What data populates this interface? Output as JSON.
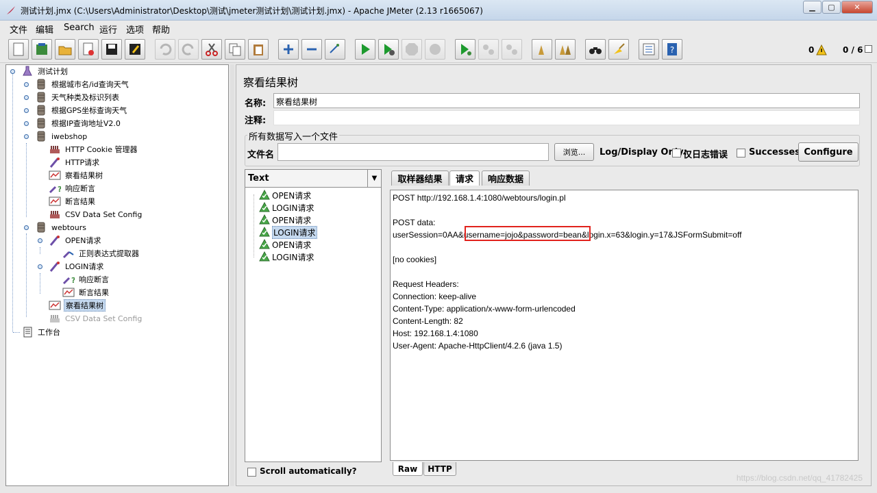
{
  "window": {
    "title": "测试计划.jmx (C:\\Users\\Administrator\\Desktop\\测试\\jmeter测试计划\\测试计划.jmx) - Apache JMeter (2.13 r1665067)",
    "minimize": "▁",
    "maximize": "▢",
    "close": "✕"
  },
  "menu": [
    "文件",
    "编辑",
    "Search",
    "运行",
    "选项",
    "帮助"
  ],
  "toolbar": {
    "warnings_count": "0",
    "threads": "0 / 6"
  },
  "tree": {
    "items": [
      {
        "label": "测试计划",
        "icon": "flask-icon"
      },
      {
        "label": "根据城市名/id查询天气",
        "icon": "thread-group-icon"
      },
      {
        "label": "天气种类及标识列表",
        "icon": "thread-group-icon"
      },
      {
        "label": "根据GPS坐标查询天气",
        "icon": "thread-group-icon"
      },
      {
        "label": "根据IP查询地址V2.0",
        "icon": "thread-group-icon"
      },
      {
        "label": "iwebshop",
        "icon": "thread-group-icon"
      },
      {
        "label": "HTTP Cookie 管理器",
        "icon": "config-icon"
      },
      {
        "label": "HTTP请求",
        "icon": "sampler-icon"
      },
      {
        "label": "察看结果树",
        "icon": "listener-icon"
      },
      {
        "label": "响应断言",
        "icon": "assertion-icon"
      },
      {
        "label": "断言结果",
        "icon": "listener-icon"
      },
      {
        "label": "CSV Data Set Config",
        "icon": "config-icon"
      },
      {
        "label": "webtours",
        "icon": "thread-group-icon"
      },
      {
        "label": "OPEN请求",
        "icon": "sampler-icon"
      },
      {
        "label": "正则表达式提取器",
        "icon": "extractor-icon"
      },
      {
        "label": "LOGIN请求",
        "icon": "sampler-icon"
      },
      {
        "label": "响应断言",
        "icon": "assertion-icon"
      },
      {
        "label": "断言结果",
        "icon": "listener-icon"
      },
      {
        "label": "察看结果树",
        "icon": "listener-icon"
      },
      {
        "label": "CSV Data Set Config",
        "icon": "config-icon"
      },
      {
        "label": "工作台",
        "icon": "workbench-icon"
      }
    ]
  },
  "panel": {
    "title": "察看结果树",
    "name_label": "名称:",
    "name_value": "察看结果树",
    "comment_label": "注释:",
    "comment_value": "",
    "group_title": "所有数据写入一个文件",
    "filename_label": "文件名",
    "filename_value": "",
    "browse_button": "浏览...",
    "log_display_label": "Log/Display Only:",
    "errors_only_label": "仅日志错误",
    "successes_label": "Successes",
    "configure_button": "Configure"
  },
  "results": {
    "renderer": "Text",
    "items": [
      "OPEN请求",
      "LOGIN请求",
      "OPEN请求",
      "LOGIN请求",
      "OPEN请求",
      "LOGIN请求"
    ],
    "scroll_label": "Scroll automatically?"
  },
  "tabs": [
    "取样器结果",
    "请求",
    "响应数据"
  ],
  "request": {
    "lines": [
      "POST http://192.168.1.4:1080/webtours/login.pl",
      "",
      "POST data:",
      "userSession=0AA&username=jojo&password=bean&login.x=63&login.y=17&JSFormSubmit=off",
      "",
      "[no cookies]",
      "",
      "Request Headers:",
      "Connection: keep-alive",
      "Content-Type: application/x-www-form-urlencoded",
      "Content-Length: 82",
      "Host: 192.168.1.4:1080",
      "User-Agent: Apache-HttpClient/4.2.6 (java 1.5)"
    ]
  },
  "bottom_tabs": [
    "Raw",
    "HTTP"
  ],
  "watermark": "https://blog.csdn.net/qq_41782425"
}
